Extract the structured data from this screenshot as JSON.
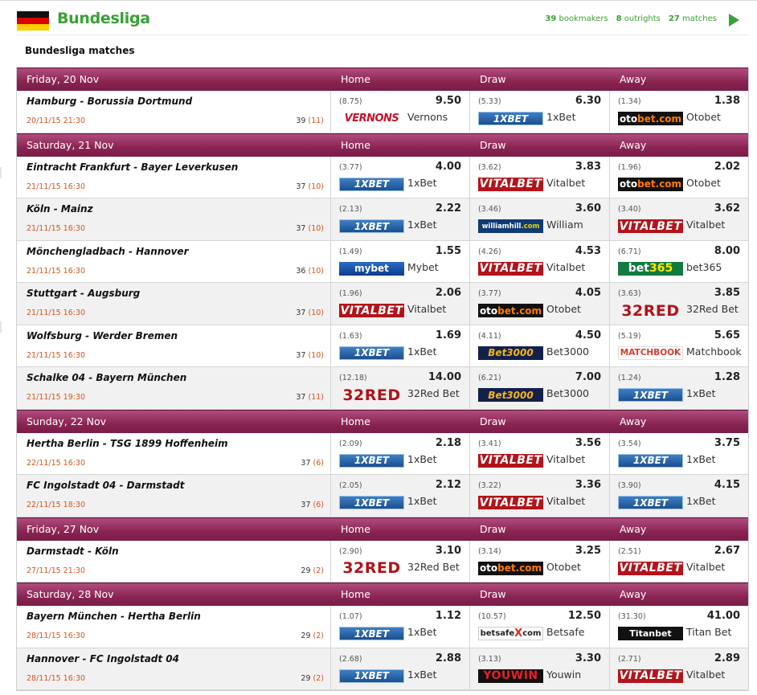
{
  "header": {
    "title": "Bundesliga",
    "stats": [
      {
        "value": "39",
        "label": "bookmakers"
      },
      {
        "value": "8",
        "label": "outrights"
      },
      {
        "value": "27",
        "label": "matches"
      }
    ],
    "flag_colors": [
      "#111111",
      "#dd0000",
      "#ffce00"
    ],
    "accent": "#39a035"
  },
  "section_title": "Bundesliga matches",
  "columns": {
    "home": "Home",
    "draw": "Draw",
    "away": "Away"
  },
  "days": [
    {
      "label": "Friday, 20 Nov",
      "matches": [
        {
          "teams": "Hamburg - Borussia Dortmund",
          "datetime": "20/11/15 21:30",
          "count": "39",
          "count2": "(11)",
          "odds": [
            {
              "avg": "(8.75)",
              "best": "9.50",
              "logo": "vernons",
              "logo_text": "VERNONS",
              "bookie": "Vernons"
            },
            {
              "avg": "(5.33)",
              "best": "6.30",
              "logo": "1xbet",
              "logo_text": "1XBET",
              "bookie": "1xBet"
            },
            {
              "avg": "(1.34)",
              "best": "1.38",
              "logo": "otobet",
              "logo_text": "oto",
              "logo_text2": "bet.com",
              "bookie": "Otobet"
            }
          ]
        }
      ]
    },
    {
      "label": "Saturday, 21 Nov",
      "matches": [
        {
          "teams": "Eintracht Frankfurt - Bayer Leverkusen",
          "datetime": "21/11/15 16:30",
          "count": "37",
          "count2": "(10)",
          "odds": [
            {
              "avg": "(3.77)",
              "best": "4.00",
              "logo": "1xbet",
              "logo_text": "1XBET",
              "bookie": "1xBet"
            },
            {
              "avg": "(3.62)",
              "best": "3.83",
              "logo": "vital",
              "logo_text": "VITALBET",
              "bookie": "Vitalbet"
            },
            {
              "avg": "(1.96)",
              "best": "2.02",
              "logo": "otobet",
              "logo_text": "oto",
              "logo_text2": "bet.com",
              "bookie": "Otobet"
            }
          ]
        },
        {
          "teams": "Köln - Mainz",
          "datetime": "21/11/15 16:30",
          "count": "37",
          "count2": "(10)",
          "odds": [
            {
              "avg": "(2.13)",
              "best": "2.22",
              "logo": "1xbet",
              "logo_text": "1XBET",
              "bookie": "1xBet"
            },
            {
              "avg": "(3.46)",
              "best": "3.60",
              "logo": "william",
              "logo_text": "williamhill",
              "logo_text2": ".com",
              "bookie": "William"
            },
            {
              "avg": "(3.40)",
              "best": "3.62",
              "logo": "vital",
              "logo_text": "VITALBET",
              "bookie": "Vitalbet"
            }
          ]
        },
        {
          "teams": "Mönchengladbach - Hannover",
          "datetime": "21/11/15 16:30",
          "count": "36",
          "count2": "(10)",
          "odds": [
            {
              "avg": "(1.49)",
              "best": "1.55",
              "logo": "mybet",
              "logo_text": "mybet",
              "bookie": "Mybet"
            },
            {
              "avg": "(4.26)",
              "best": "4.53",
              "logo": "vital",
              "logo_text": "VITALBET",
              "bookie": "Vitalbet"
            },
            {
              "avg": "(6.71)",
              "best": "8.00",
              "logo": "bet365",
              "logo_text": "bet",
              "logo_text2": "365",
              "bookie": "bet365"
            }
          ]
        },
        {
          "teams": "Stuttgart - Augsburg",
          "datetime": "21/11/15 16:30",
          "count": "37",
          "count2": "(10)",
          "odds": [
            {
              "avg": "(1.96)",
              "best": "2.06",
              "logo": "vital",
              "logo_text": "VITALBET",
              "bookie": "Vitalbet"
            },
            {
              "avg": "(3.77)",
              "best": "4.05",
              "logo": "otobet",
              "logo_text": "oto",
              "logo_text2": "bet.com",
              "bookie": "Otobet"
            },
            {
              "avg": "(3.63)",
              "best": "3.85",
              "logo": "32red",
              "logo_text": "32RED",
              "bookie": "32Red Bet"
            }
          ]
        },
        {
          "teams": "Wolfsburg - Werder Bremen",
          "datetime": "21/11/15 16:30",
          "count": "37",
          "count2": "(10)",
          "odds": [
            {
              "avg": "(1.63)",
              "best": "1.69",
              "logo": "1xbet",
              "logo_text": "1XBET",
              "bookie": "1xBet"
            },
            {
              "avg": "(4.11)",
              "best": "4.50",
              "logo": "bet3000",
              "logo_text": "Bet3000",
              "bookie": "Bet3000"
            },
            {
              "avg": "(5.19)",
              "best": "5.65",
              "logo": "matchbook",
              "logo_text": "MATCHBOOK",
              "bookie": "Matchbook"
            }
          ]
        },
        {
          "teams": "Schalke 04 - Bayern München",
          "datetime": "21/11/15 19:30",
          "count": "37",
          "count2": "(11)",
          "odds": [
            {
              "avg": "(12.18)",
              "best": "14.00",
              "logo": "32red",
              "logo_text": "32RED",
              "bookie": "32Red Bet"
            },
            {
              "avg": "(6.21)",
              "best": "7.00",
              "logo": "bet3000",
              "logo_text": "Bet3000",
              "bookie": "Bet3000"
            },
            {
              "avg": "(1.24)",
              "best": "1.28",
              "logo": "1xbet",
              "logo_text": "1XBET",
              "bookie": "1xBet"
            }
          ]
        }
      ]
    },
    {
      "label": "Sunday, 22 Nov",
      "matches": [
        {
          "teams": "Hertha Berlin - TSG 1899 Hoffenheim",
          "datetime": "22/11/15 16:30",
          "count": "37",
          "count2": "(6)",
          "odds": [
            {
              "avg": "(2.09)",
              "best": "2.18",
              "logo": "1xbet",
              "logo_text": "1XBET",
              "bookie": "1xBet"
            },
            {
              "avg": "(3.41)",
              "best": "3.56",
              "logo": "vital",
              "logo_text": "VITALBET",
              "bookie": "Vitalbet"
            },
            {
              "avg": "(3.54)",
              "best": "3.75",
              "logo": "1xbet",
              "logo_text": "1XBET",
              "bookie": "1xBet"
            }
          ]
        },
        {
          "teams": "FC Ingolstadt 04 - Darmstadt",
          "datetime": "22/11/15 18:30",
          "count": "37",
          "count2": "(6)",
          "odds": [
            {
              "avg": "(2.05)",
              "best": "2.12",
              "logo": "1xbet",
              "logo_text": "1XBET",
              "bookie": "1xBet"
            },
            {
              "avg": "(3.22)",
              "best": "3.36",
              "logo": "vital",
              "logo_text": "VITALBET",
              "bookie": "Vitalbet"
            },
            {
              "avg": "(3.90)",
              "best": "4.15",
              "logo": "1xbet",
              "logo_text": "1XBET",
              "bookie": "1xBet"
            }
          ]
        }
      ]
    },
    {
      "label": "Friday, 27 Nov",
      "matches": [
        {
          "teams": "Darmstadt - Köln",
          "datetime": "27/11/15 21:30",
          "count": "29",
          "count2": "(2)",
          "odds": [
            {
              "avg": "(2.90)",
              "best": "3.10",
              "logo": "32red",
              "logo_text": "32RED",
              "bookie": "32Red Bet"
            },
            {
              "avg": "(3.14)",
              "best": "3.25",
              "logo": "otobet",
              "logo_text": "oto",
              "logo_text2": "bet.com",
              "bookie": "Otobet"
            },
            {
              "avg": "(2.51)",
              "best": "2.67",
              "logo": "vital",
              "logo_text": "VITALBET",
              "bookie": "Vitalbet"
            }
          ]
        }
      ]
    },
    {
      "label": "Saturday, 28 Nov",
      "matches": [
        {
          "teams": "Bayern München - Hertha Berlin",
          "datetime": "28/11/15 16:30",
          "count": "29",
          "count2": "(2)",
          "odds": [
            {
              "avg": "(1.07)",
              "best": "1.12",
              "logo": "1xbet",
              "logo_text": "1XBET",
              "bookie": "1xBet"
            },
            {
              "avg": "(10.57)",
              "best": "12.50",
              "logo": "betsafe",
              "logo_text": "betsafe",
              "logo_text2": "X",
              "logo_text3": "com",
              "bookie": "Betsafe"
            },
            {
              "avg": "(31.30)",
              "best": "41.00",
              "logo": "titan",
              "logo_text": "Titanbet",
              "bookie": "Titan Bet"
            }
          ]
        },
        {
          "teams": "Hannover - FC Ingolstadt 04",
          "datetime": "28/11/15 16:30",
          "count": "29",
          "count2": "(2)",
          "odds": [
            {
              "avg": "(2.68)",
              "best": "2.88",
              "logo": "1xbet",
              "logo_text": "1XBET",
              "bookie": "1xBet"
            },
            {
              "avg": "(3.13)",
              "best": "3.30",
              "logo": "youwin",
              "logo_text": "YOUWIN",
              "bookie": "Youwin"
            },
            {
              "avg": "(2.71)",
              "best": "2.89",
              "logo": "vital",
              "logo_text": "VITALBET",
              "bookie": "Vitalbet"
            }
          ]
        }
      ]
    }
  ]
}
